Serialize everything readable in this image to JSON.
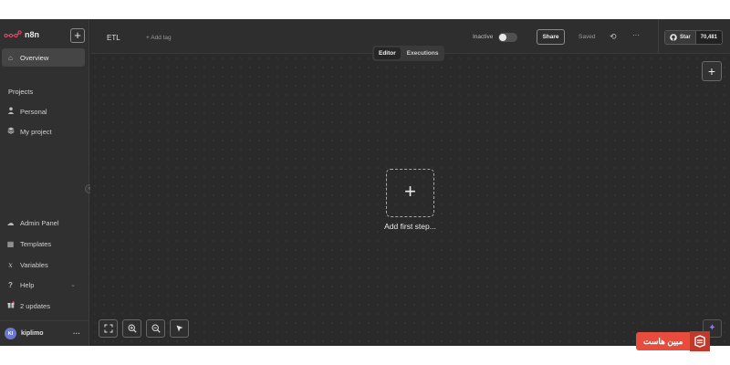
{
  "app": {
    "name": "n8n",
    "brand_color": "#ea4b71"
  },
  "sidebar": {
    "add_label": "+",
    "overview": "Overview",
    "projects_title": "Projects",
    "projects": [
      "Personal",
      "My project"
    ],
    "bottom_items": [
      {
        "label": "Admin Panel",
        "icon": "cloud-icon"
      },
      {
        "label": "Templates",
        "icon": "templates-icon"
      },
      {
        "label": "Variables",
        "icon": "variables-icon"
      },
      {
        "label": "Help",
        "icon": "help-icon"
      },
      {
        "label": "2 updates",
        "icon": "gift-icon"
      }
    ],
    "user": {
      "initials": "KI",
      "name": "kiplimo"
    }
  },
  "header": {
    "workflow_name": "ETL",
    "add_tag": "+ Add tag",
    "active_state_label": "Inactive",
    "share_label": "Share",
    "save_status": "Saved",
    "github": {
      "star_label": "Star",
      "count": "70,481"
    }
  },
  "tabs": [
    {
      "label": "Editor",
      "active": true
    },
    {
      "label": "Executions",
      "active": false
    }
  ],
  "canvas": {
    "add_first_step": "Add first step..."
  },
  "watermark": {
    "text": "مبین هاست"
  }
}
